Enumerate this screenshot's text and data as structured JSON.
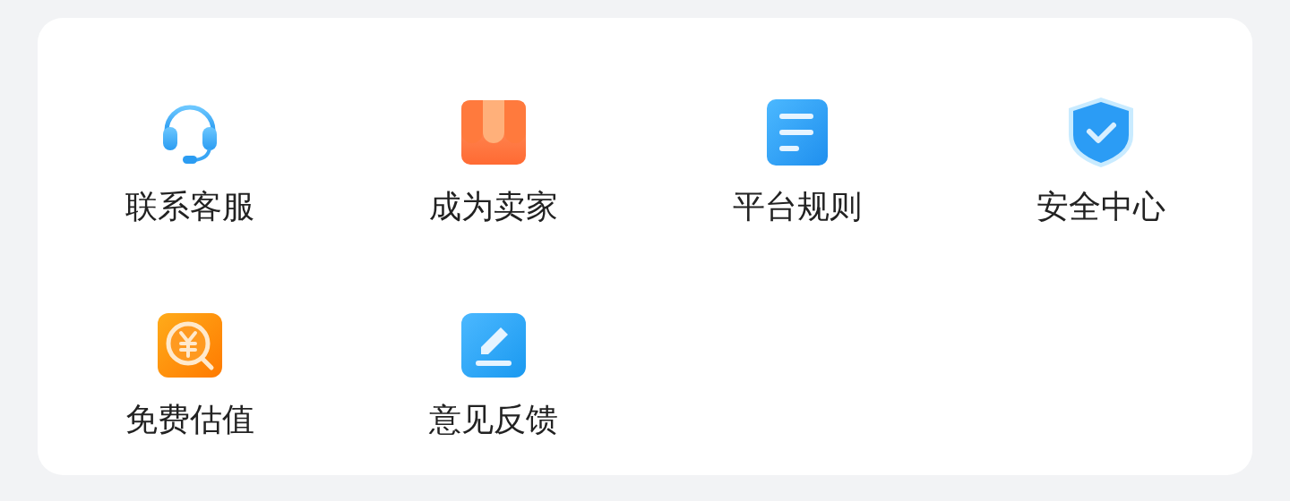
{
  "services": [
    {
      "kind": "support",
      "label": "联系客服"
    },
    {
      "kind": "seller",
      "label": "成为卖家"
    },
    {
      "kind": "rules",
      "label": "平台规则"
    },
    {
      "kind": "security",
      "label": "安全中心"
    },
    {
      "kind": "valuation",
      "label": "免费估值"
    },
    {
      "kind": "feedback",
      "label": "意见反馈"
    }
  ]
}
